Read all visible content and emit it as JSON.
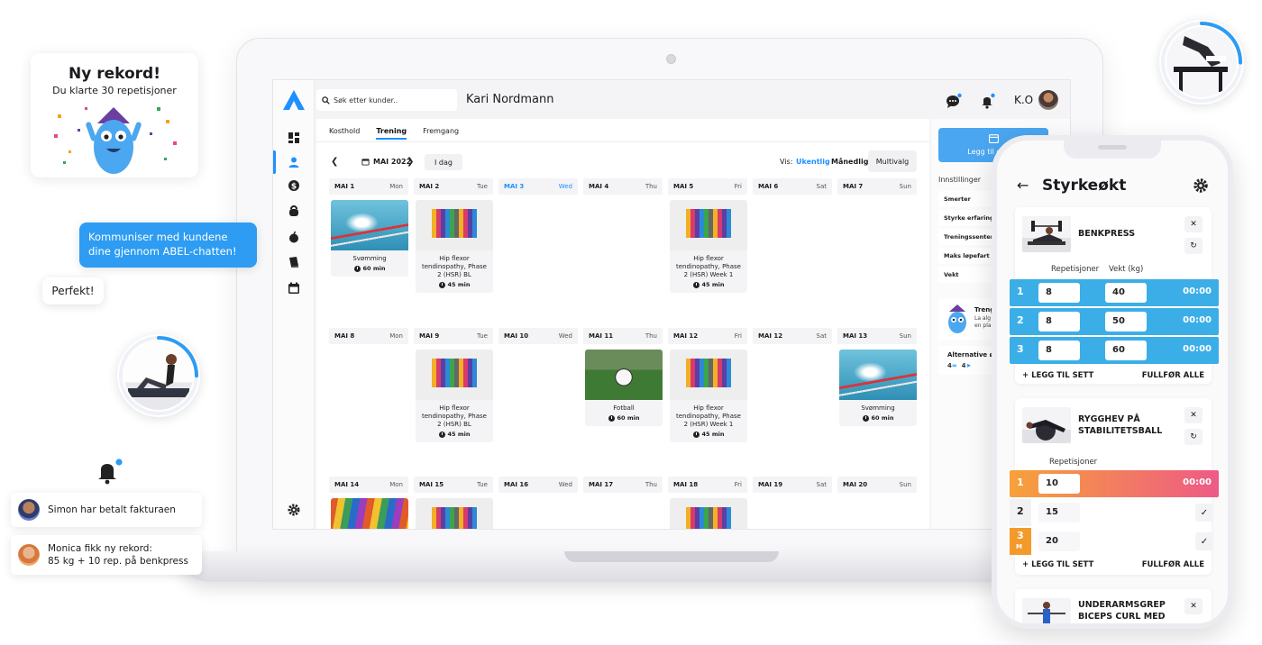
{
  "colors": {
    "accent": "#1e90ff",
    "chat_bubble": "#2d9cf2",
    "set_row": "#3baee8",
    "set_gradient_start": "#f7a13a",
    "set_gradient_end": "#ee5a86"
  },
  "record_card": {
    "title": "Ny rekord!",
    "subtitle": "Du klarte 30 repetisjoner"
  },
  "chat": {
    "message": "Kommuniser med kundene dine gjennom ABEL-chatten!",
    "reply": "Perfekt!"
  },
  "notifications": [
    {
      "text": "Simon har betalt fakturaen"
    },
    {
      "line1": "Monica fikk ny rekord:",
      "line2": "85 kg + 10 rep. på benkpress"
    }
  ],
  "laptop": {
    "search_placeholder": "Søk etter kunder..",
    "client_name": "Kari Nordmann",
    "user_initials": "K.O",
    "sidebar_icons": [
      "dashboard-icon",
      "user-icon",
      "dollar-icon",
      "kettlebell-icon",
      "apple-icon",
      "book-icon",
      "calendar-icon",
      "settings-icon"
    ],
    "tabs": [
      "Kosthold",
      "Trening",
      "Fremgang"
    ],
    "active_tab": "Trening",
    "month": "MAI 2022",
    "today": "I dag",
    "view_label": "Vis:",
    "view_week": "Ukentlig",
    "view_month": "Månedlig",
    "multiselect": "Multivalg",
    "weeks": [
      [
        {
          "date": "MAI 1",
          "weekday": "Mon",
          "event": {
            "title": "Svømming",
            "duration": "60 min",
            "img": "swim"
          }
        },
        {
          "date": "MAI 2",
          "weekday": "Tue",
          "event": {
            "title": "Hip flexor tendinopathy, Phase 2 (HSR) BL",
            "duration": "45 min",
            "img": "weights"
          }
        },
        {
          "date": "MAI 3",
          "weekday": "Wed",
          "today": true
        },
        {
          "date": "MAI 4",
          "weekday": "Thu"
        },
        {
          "date": "MAI 5",
          "weekday": "Fri",
          "event": {
            "title": "Hip flexor tendinopathy, Phase 2 (HSR) Week 1",
            "duration": "45 min",
            "img": "weights"
          }
        },
        {
          "date": "MAI 6",
          "weekday": "Sat"
        },
        {
          "date": "MAI 7",
          "weekday": "Sun"
        }
      ],
      [
        {
          "date": "MAI 8",
          "weekday": "Mon"
        },
        {
          "date": "MAI 9",
          "weekday": "Tue",
          "event": {
            "title": "Hip flexor tendinopathy, Phase 2 (HSR) BL",
            "duration": "45 min",
            "img": "weights"
          }
        },
        {
          "date": "MAI 10",
          "weekday": "Wed"
        },
        {
          "date": "MAI 11",
          "weekday": "Thu",
          "event": {
            "title": "Fotball",
            "duration": "60 min",
            "img": "ball"
          }
        },
        {
          "date": "MAI 12",
          "weekday": "Fri",
          "event": {
            "title": "Hip flexor tendinopathy, Phase 2 (HSR) Week 1",
            "duration": "45 min",
            "img": "weights"
          }
        },
        {
          "date": "MAI 12",
          "weekday": "Sat"
        },
        {
          "date": "MAI 13",
          "weekday": "Sun",
          "event": {
            "title": "Svømming",
            "duration": "60 min",
            "img": "swim"
          }
        }
      ],
      [
        {
          "date": "MAI 14",
          "weekday": "Mon",
          "event": {
            "title": "",
            "duration": "",
            "img": "pencils"
          }
        },
        {
          "date": "MAI 15",
          "weekday": "Tue",
          "event": {
            "title": "",
            "duration": "",
            "img": "weights"
          }
        },
        {
          "date": "MAI 16",
          "weekday": "Wed"
        },
        {
          "date": "MAI 17",
          "weekday": "Thu"
        },
        {
          "date": "MAI 18",
          "weekday": "Fri",
          "event": {
            "title": "",
            "duration": "",
            "img": "weights"
          }
        },
        {
          "date": "MAI 19",
          "weekday": "Sat"
        },
        {
          "date": "MAI 20",
          "weekday": "Sun"
        }
      ]
    ],
    "right_panel": {
      "add_button": "Legg til en økt",
      "settings_title": "Innstillinger",
      "settings": [
        "Smerter",
        "Styrke erfaringsn",
        "Treningssenter",
        "Maks løpefart",
        "Vekt"
      ],
      "assistant_title": "Treng",
      "assistant_sub_1": "La alg",
      "assistant_sub_2": "en pla",
      "alternatives_title": "Alternative øk",
      "alternatives_a": "4",
      "alternatives_b": "4"
    }
  },
  "phone": {
    "title": "Styrkeøkt",
    "add_set": "LEGG TIL SETT",
    "complete_all": "FULLFØR ALLE",
    "exercise1": {
      "name": "BENKPRESS",
      "col_reps": "Repetisjoner",
      "col_weight": "Vekt (kg)",
      "sets": [
        {
          "num": "1",
          "reps": "8",
          "weight": "40",
          "time": "00:00"
        },
        {
          "num": "2",
          "reps": "8",
          "weight": "50",
          "time": "00:00"
        },
        {
          "num": "3",
          "reps": "8",
          "weight": "60",
          "time": "00:00"
        }
      ]
    },
    "exercise2": {
      "name_line1": "RYGGHEV PÅ",
      "name_line2": "STABILITETSBALL",
      "col_reps": "Repetisjoner",
      "set1": {
        "num": "1",
        "reps": "10",
        "time": "00:00"
      },
      "set2": {
        "num": "2",
        "reps": "15"
      },
      "set3": {
        "num": "3",
        "badge": "M",
        "reps": "20"
      }
    },
    "exercise3": {
      "name_line1": "UNDERARMSGREP",
      "name_line2": "BICEPS CURL MED"
    }
  }
}
